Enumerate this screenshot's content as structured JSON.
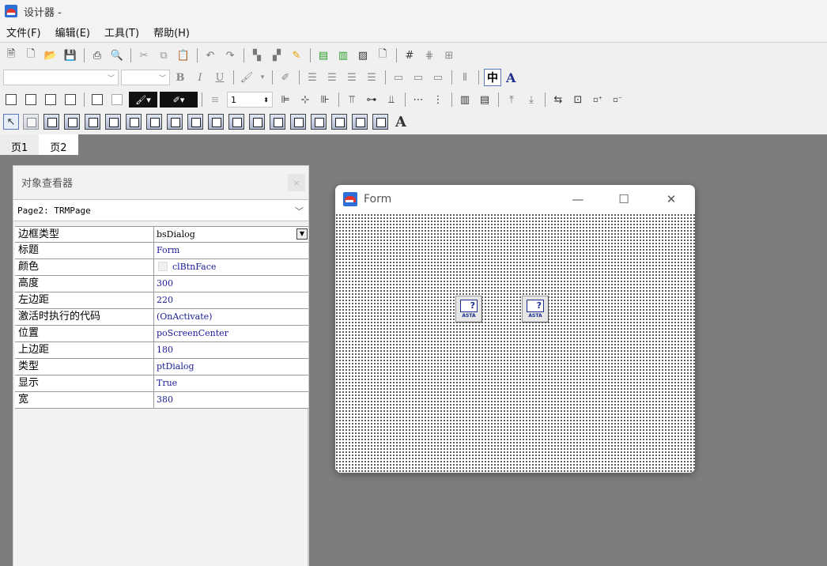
{
  "window": {
    "title": "设计器 -"
  },
  "menu": [
    "文件(F)",
    "编辑(E)",
    "工具(T)",
    "帮助(H)"
  ],
  "toolbar": {
    "line_width_value": "1",
    "format_chinese_label": "中",
    "font_button_label": "A",
    "bold_label": "B",
    "italic_label": "I",
    "underline_label": "U"
  },
  "tabs": [
    {
      "label": "页1",
      "active": false
    },
    {
      "label": "页2",
      "active": true
    }
  ],
  "inspector": {
    "title": "对象查看器",
    "close_label": "×",
    "object_selector": "Page2: TRMPage",
    "properties": [
      {
        "name": "边框类型",
        "value": "bsDialog",
        "dropdown": true
      },
      {
        "name": "标题",
        "value": "Form"
      },
      {
        "name": "颜色",
        "value": "clBtnFace",
        "swatch": "#efefef"
      },
      {
        "name": "高度",
        "value": "300"
      },
      {
        "name": "左边距",
        "value": "220"
      },
      {
        "name": "激活时执行的代码",
        "value": "(OnActivate)"
      },
      {
        "name": "位置",
        "value": "poScreenCenter"
      },
      {
        "name": "上边距",
        "value": "180"
      },
      {
        "name": "类型",
        "value": "ptDialog"
      },
      {
        "name": "显示",
        "value": "True"
      },
      {
        "name": "宽",
        "value": "380"
      }
    ]
  },
  "form_window": {
    "title": "Form",
    "minimize": "—",
    "maximize": "☐",
    "close": "✕",
    "component_label": "ASTA",
    "component_glyph": "?"
  },
  "colors": {
    "app_icon_blue": "#2b6fd6",
    "app_icon_red": "#e8352b",
    "property_value_text": "#1b1b99",
    "workspace_bg": "#7d7d7d"
  }
}
